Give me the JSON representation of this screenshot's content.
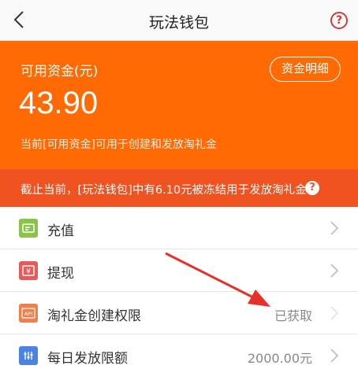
{
  "navbar": {
    "title": "玩法钱包",
    "help_symbol": "?"
  },
  "balance": {
    "label": "可用资金(元)",
    "amount": "43.90",
    "note": "当前[可用资金]可用于创建和发放淘礼金",
    "detail_button": "资金明细",
    "background_color": "#ff6a05"
  },
  "freeze_notice": {
    "text": "截止当前，[玩法钱包]中有6.10元被冻结用于发放淘礼金",
    "help_symbol": "?",
    "background_color": "#f05220"
  },
  "menu": {
    "items": [
      {
        "label": "充值",
        "value": "",
        "icon": "recharge-icon",
        "icon_color": "#8bc34a"
      },
      {
        "label": "提现",
        "value": "",
        "icon": "withdraw-icon",
        "icon_color": "#e65b57"
      },
      {
        "label": "淘礼金创建权限",
        "value": "已获取",
        "icon": "api-icon",
        "icon_color": "#f07f4a"
      },
      {
        "label": "每日发放限额",
        "value": "2000.00元",
        "icon": "limit-icon",
        "icon_color": "#4b82e6"
      }
    ]
  }
}
